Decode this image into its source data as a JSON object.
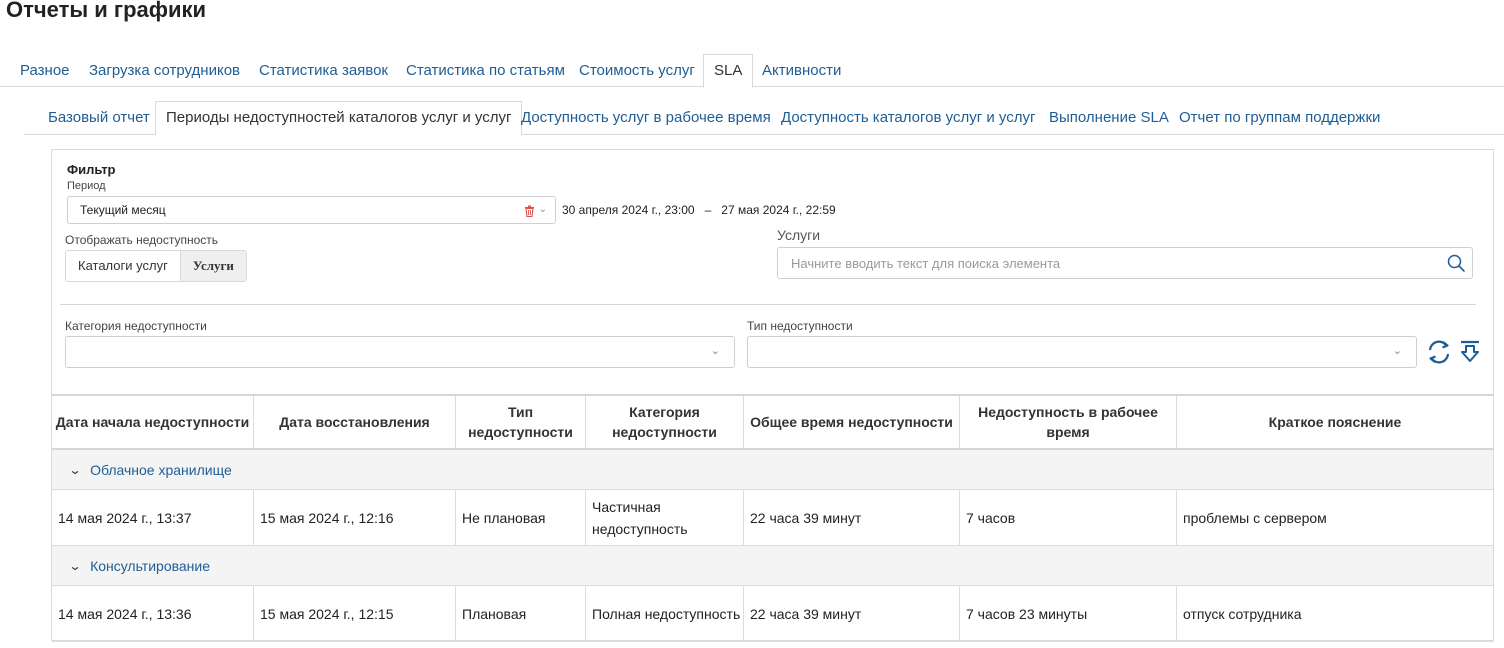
{
  "page": {
    "title": "Отчеты и графики"
  },
  "tabs_main": [
    {
      "label": "Разное",
      "active": false
    },
    {
      "label": "Загрузка сотрудников",
      "active": false
    },
    {
      "label": "Статистика заявок",
      "active": false
    },
    {
      "label": "Статистика по статьям",
      "active": false
    },
    {
      "label": "Стоимость услуг",
      "active": false
    },
    {
      "label": "SLA",
      "active": true
    },
    {
      "label": "Активности",
      "active": false
    }
  ],
  "tabs_sub": [
    {
      "label": "Базовый отчет",
      "active": false
    },
    {
      "label": "Периоды недоступностей каталогов услуг и услуг",
      "active": true
    },
    {
      "label": "Доступность услуг в рабочее время",
      "active": false
    },
    {
      "label": "Доступность каталогов услуг и услуг",
      "active": false
    },
    {
      "label": "Выполнение SLA",
      "active": false
    },
    {
      "label": "Отчет по группам поддержки",
      "active": false
    }
  ],
  "filter": {
    "title": "Фильтр",
    "period_label": "Период",
    "period_value": "Текущий месяц",
    "date_from": "30 апреля 2024 г., 23:00",
    "date_separator": "–",
    "date_to": "27 мая 2024 г., 22:59",
    "show_label": "Отображать недоступность",
    "show_options": [
      "Каталоги услуг",
      "Услуги"
    ],
    "show_selected": "Услуги",
    "services_label": "Услуги",
    "services_placeholder": "Начните вводить текст для поиска элемента",
    "category_label": "Категория недоступности",
    "type_label": "Тип недоступности"
  },
  "table": {
    "headers": [
      "Дата начала недоступности",
      "Дата восстановления",
      "Тип недоступности",
      "Категория недоступности",
      "Общее время недоступности",
      "Недоступность в рабочее время",
      "Краткое пояснение"
    ],
    "groups": [
      {
        "name": "Облачное хранилище",
        "rows": [
          [
            "14 мая 2024 г., 13:37",
            "15 мая 2024 г., 12:16",
            "Не плановая",
            "Частичная недоступность",
            "22 часа 39 минут",
            "7 часов",
            "проблемы с сервером"
          ]
        ]
      },
      {
        "name": "Консультирование",
        "rows": [
          [
            "14 мая 2024 г., 13:36",
            "15 мая 2024 г., 12:15",
            "Плановая",
            "Полная недоступность",
            "22 часа 39 минут",
            "7 часов 23 минуты",
            "отпуск сотрудника"
          ]
        ]
      }
    ]
  },
  "colors": {
    "link": "#1f5d95",
    "border": "#d9d9d9",
    "group_bg": "#f4f4f4",
    "delete": "#d9534f",
    "icon": "#1f5d95"
  },
  "icons": {
    "refresh": "refresh-icon",
    "export": "export-icon",
    "search": "search-icon",
    "delete": "trash-icon"
  }
}
